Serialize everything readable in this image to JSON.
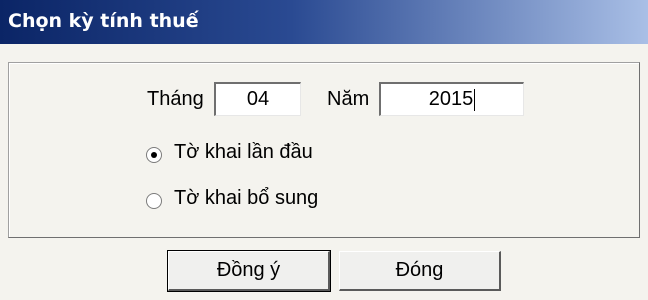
{
  "dialog": {
    "title": "Chọn kỳ tính thuế"
  },
  "period": {
    "month_label": "Tháng",
    "month_value": "04",
    "year_label": "Năm",
    "year_value": "2015"
  },
  "declaration_type": {
    "options": [
      {
        "label": "Tờ khai lần đầu",
        "selected": true
      },
      {
        "label": "Tờ khai bổ sung",
        "selected": false
      }
    ]
  },
  "buttons": {
    "ok_label": "Đồng ý",
    "close_label": "Đóng"
  }
}
